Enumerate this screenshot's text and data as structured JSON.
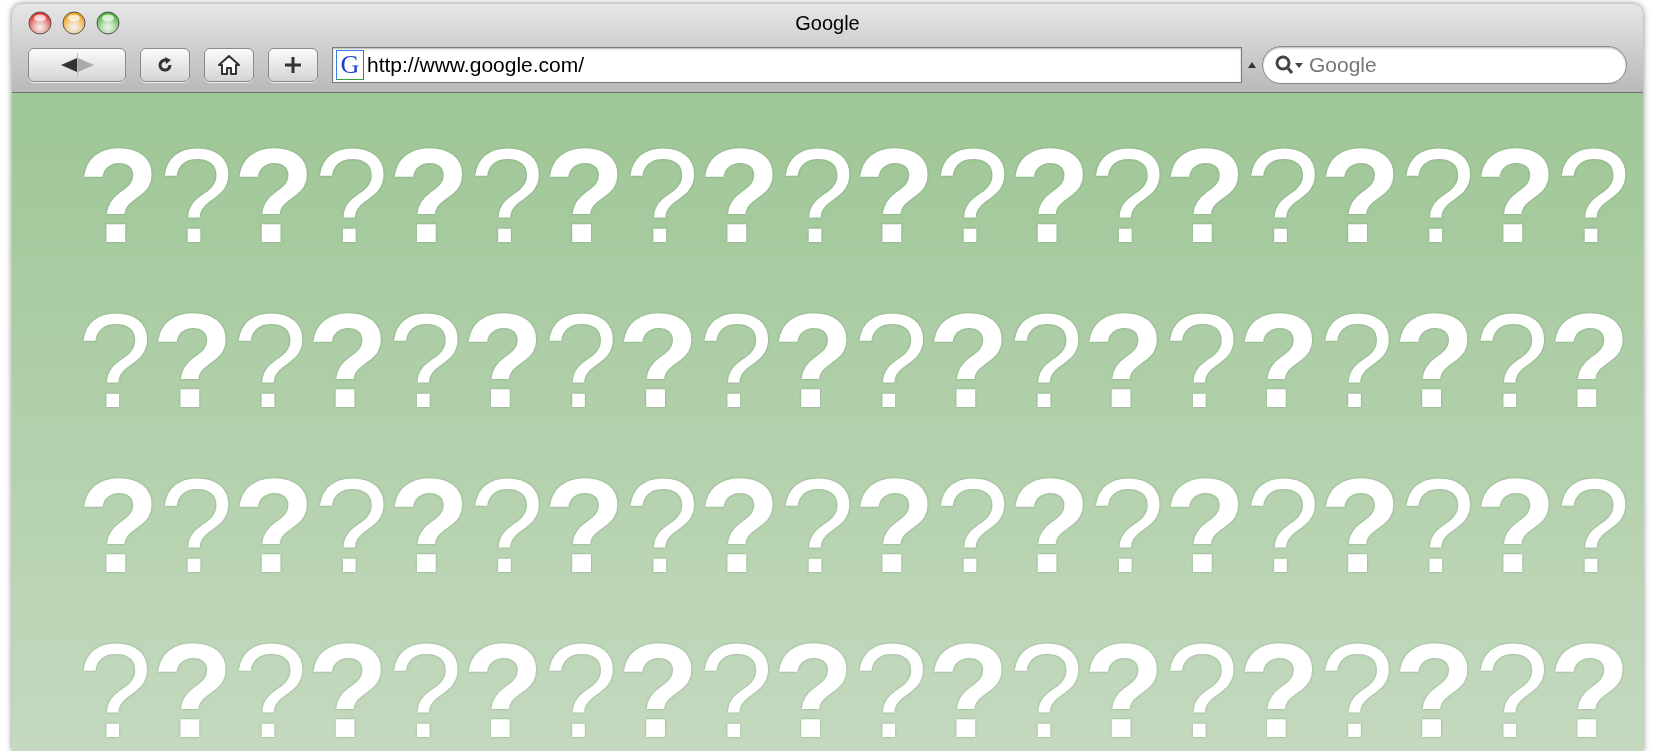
{
  "window": {
    "title": "Google"
  },
  "toolbar": {
    "favicon": "G",
    "address": "http://www.google.com/",
    "search": {
      "placeholder": "Google"
    }
  },
  "page": {
    "rows": [
      [
        {
          "text": "?",
          "bold": true
        },
        {
          "text": "?",
          "bold": false
        },
        {
          "text": "?",
          "bold": true
        },
        {
          "text": "?",
          "bold": false
        },
        {
          "text": "?",
          "bold": true
        },
        {
          "text": "?",
          "bold": false
        },
        {
          "text": "?",
          "bold": true
        },
        {
          "text": "?",
          "bold": false
        },
        {
          "text": "?",
          "bold": true
        },
        {
          "text": "?",
          "bold": false
        },
        {
          "text": "?",
          "bold": true
        },
        {
          "text": "?",
          "bold": false
        },
        {
          "text": "?",
          "bold": true
        },
        {
          "text": "?",
          "bold": false
        },
        {
          "text": "?",
          "bold": true
        },
        {
          "text": "?",
          "bold": false
        },
        {
          "text": "?",
          "bold": true
        },
        {
          "text": "?",
          "bold": false
        },
        {
          "text": "?",
          "bold": true
        },
        {
          "text": "?",
          "bold": false
        }
      ],
      [
        {
          "text": "?",
          "bold": false
        },
        {
          "text": "?",
          "bold": true
        },
        {
          "text": "?",
          "bold": false
        },
        {
          "text": "?",
          "bold": true
        },
        {
          "text": "?",
          "bold": false
        },
        {
          "text": "?",
          "bold": true
        },
        {
          "text": "?",
          "bold": false
        },
        {
          "text": "?",
          "bold": true
        },
        {
          "text": "?",
          "bold": false
        },
        {
          "text": "?",
          "bold": true
        },
        {
          "text": "?",
          "bold": false
        },
        {
          "text": "?",
          "bold": true
        },
        {
          "text": "?",
          "bold": false
        },
        {
          "text": "?",
          "bold": true
        },
        {
          "text": "?",
          "bold": false
        },
        {
          "text": "?",
          "bold": true
        },
        {
          "text": "?",
          "bold": false
        },
        {
          "text": "?",
          "bold": true
        },
        {
          "text": "?",
          "bold": false
        },
        {
          "text": "?",
          "bold": true
        }
      ],
      [
        {
          "text": "?",
          "bold": true
        },
        {
          "text": "?",
          "bold": false
        },
        {
          "text": "?",
          "bold": true
        },
        {
          "text": "?",
          "bold": false
        },
        {
          "text": "?",
          "bold": true
        },
        {
          "text": "?",
          "bold": false
        },
        {
          "text": "?",
          "bold": true
        },
        {
          "text": "?",
          "bold": false
        },
        {
          "text": "?",
          "bold": true
        },
        {
          "text": "?",
          "bold": false
        },
        {
          "text": "?",
          "bold": true
        },
        {
          "text": "?",
          "bold": false
        },
        {
          "text": "?",
          "bold": true
        },
        {
          "text": "?",
          "bold": false
        },
        {
          "text": "?",
          "bold": true
        },
        {
          "text": "?",
          "bold": false
        },
        {
          "text": "?",
          "bold": true
        },
        {
          "text": "?",
          "bold": false
        },
        {
          "text": "?",
          "bold": true
        },
        {
          "text": "?",
          "bold": false
        }
      ],
      [
        {
          "text": "?",
          "bold": false
        },
        {
          "text": "?",
          "bold": true
        },
        {
          "text": "?",
          "bold": false
        },
        {
          "text": "?",
          "bold": true
        },
        {
          "text": "?",
          "bold": false
        },
        {
          "text": "?",
          "bold": true
        },
        {
          "text": "?",
          "bold": false
        },
        {
          "text": "?",
          "bold": true
        },
        {
          "text": "?",
          "bold": false
        },
        {
          "text": "?",
          "bold": true
        },
        {
          "text": "?",
          "bold": false
        },
        {
          "text": "?",
          "bold": true
        },
        {
          "text": "?",
          "bold": false
        },
        {
          "text": "?",
          "bold": true
        },
        {
          "text": "?",
          "bold": false
        },
        {
          "text": "?",
          "bold": true
        },
        {
          "text": "?",
          "bold": false
        },
        {
          "text": "?",
          "bold": true
        },
        {
          "text": "?",
          "bold": false
        },
        {
          "text": "?",
          "bold": true
        }
      ]
    ]
  }
}
